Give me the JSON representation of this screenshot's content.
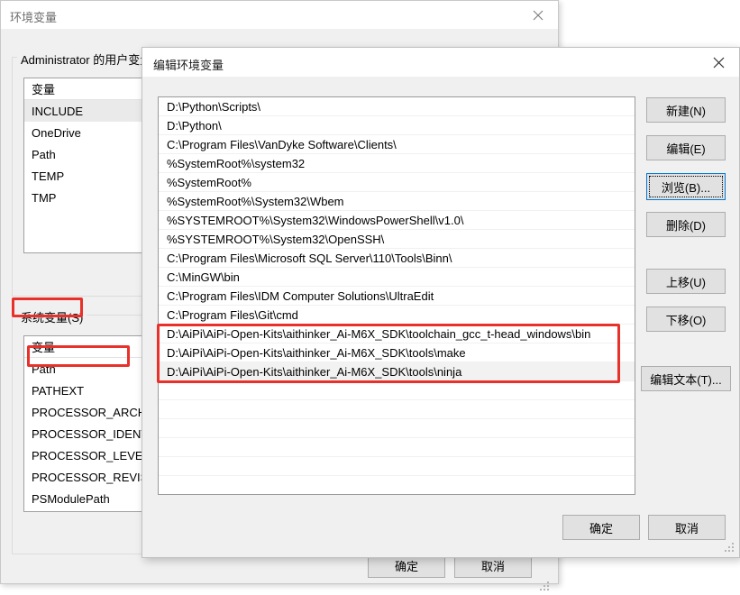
{
  "background_window": {
    "title": "环境变量",
    "close_icon": "close-icon",
    "user_vars": {
      "group_label": "Administrator 的用户变量(U)",
      "column_header": "变量",
      "rows": [
        "INCLUDE",
        "OneDrive",
        "Path",
        "TEMP",
        "TMP"
      ],
      "selected": "INCLUDE"
    },
    "system_vars": {
      "group_label": "系统变量(S)",
      "column_header": "变量",
      "rows": [
        "Path",
        "PATHEXT",
        "PROCESSOR_ARCHIT",
        "PROCESSOR_IDENTIF",
        "PROCESSOR_LEVEL",
        "PROCESSOR_REVISIO",
        "PSModulePath"
      ],
      "highlighted": "Path"
    },
    "buttons": {
      "ok": "确定",
      "cancel": "取消"
    }
  },
  "edit_dialog": {
    "title": "编辑环境变量",
    "close_icon": "close-icon",
    "paths": [
      "D:\\Python\\Scripts\\",
      "D:\\Python\\",
      "C:\\Program Files\\VanDyke Software\\Clients\\",
      "%SystemRoot%\\system32",
      "%SystemRoot%",
      "%SystemRoot%\\System32\\Wbem",
      "%SYSTEMROOT%\\System32\\WindowsPowerShell\\v1.0\\",
      "%SYSTEMROOT%\\System32\\OpenSSH\\",
      "C:\\Program Files\\Microsoft SQL Server\\110\\Tools\\Binn\\",
      "C:\\MinGW\\bin",
      "C:\\Program Files\\IDM Computer Solutions\\UltraEdit",
      "C:\\Program Files\\Git\\cmd",
      "D:\\AiPi\\AiPi-Open-Kits\\aithinker_Ai-M6X_SDK\\toolchain_gcc_t-head_windows\\bin",
      "D:\\AiPi\\AiPi-Open-Kits\\aithinker_Ai-M6X_SDK\\tools\\make",
      "D:\\AiPi\\AiPi-Open-Kits\\aithinker_Ai-M6X_SDK\\tools\\ninja"
    ],
    "selected_index": 14,
    "side_buttons": {
      "new": "新建(N)",
      "edit": "编辑(E)",
      "browse": "浏览(B)...",
      "delete": "删除(D)",
      "move_up": "上移(U)",
      "move_down": "下移(O)",
      "edit_text": "编辑文本(T)..."
    },
    "focused_button": "浏览(B)...",
    "buttons": {
      "ok": "确定",
      "cancel": "取消"
    }
  },
  "annotations": {
    "accent_color": "#e8312b",
    "boxes": [
      "系统变量(S)",
      "Path",
      "AiPi SDK path entries"
    ]
  }
}
